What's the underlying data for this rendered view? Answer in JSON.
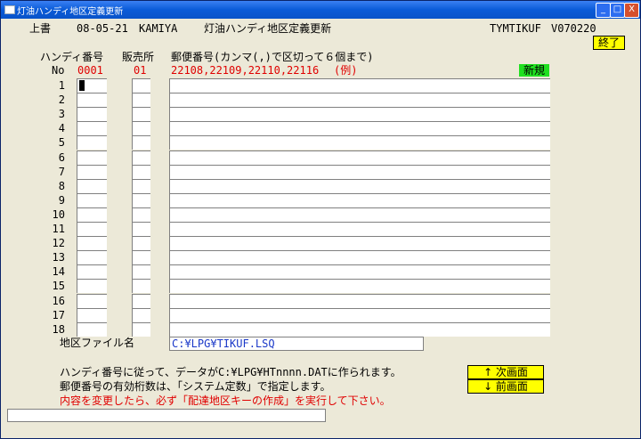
{
  "window": {
    "title": "灯油ハンディ地区定義更新",
    "minimize": "_",
    "maximize": "□",
    "close": "X"
  },
  "header": {
    "mode": "上書",
    "date": "08-05-21",
    "user": "KAMIYA",
    "screen_title": "灯油ハンディ地区定義更新",
    "program_id": "TYMTIKUF",
    "version": "V070220",
    "end_button": "終了"
  },
  "columns": {
    "handy_no": "ハンディ番号",
    "store": "販売所",
    "postal": "郵便番号(カンマ(,)で区切って６個まで)"
  },
  "example_row": {
    "label": "No",
    "handy_no": "0001",
    "store": "01",
    "postal": "22108,22109,22110,22116",
    "example_tag": "(例)",
    "new_badge": "新規"
  },
  "rows": [
    "1",
    "2",
    "3",
    "4",
    "5",
    "6",
    "7",
    "8",
    "9",
    "10",
    "11",
    "12",
    "13",
    "14",
    "15",
    "16",
    "17",
    "18"
  ],
  "file": {
    "label": "地区ファイル名",
    "value": "C:¥LPG¥TIKUF.LSQ"
  },
  "notes": {
    "line1": "ハンディ番号に従って、データがC:¥LPG¥HTnnnn.DATに作られます。",
    "line2": "郵便番号の有効桁数は、「システム定数」で指定します。",
    "line3": "内容を変更したら、必ず「配達地区キーの作成」を実行して下さい。"
  },
  "nav": {
    "next": "↑ 次画面",
    "prev": "↓ 前画面"
  },
  "colors": {
    "titlebar": "#0a5bd8",
    "background": "#ece9d8",
    "accent_yellow": "#ffff00",
    "accent_green": "#20e020",
    "warning_red": "#e00000",
    "path_blue": "#1a38c8"
  }
}
